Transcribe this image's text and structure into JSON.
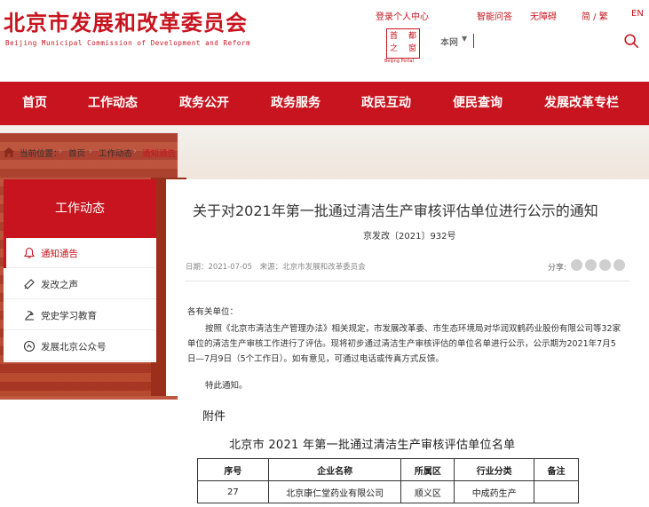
{
  "header": {
    "title_cn": "北京市发展和改革委员会",
    "title_en": "Beijing Municipal Commission of Development and Reform",
    "links": {
      "login": "登录个人中心",
      "elder": "智能问答",
      "accessibility": "无障碍",
      "lang": "简 / 繁",
      "en": "EN"
    },
    "seal": {
      "c1": "首",
      "c2": "都",
      "c3": "之",
      "c4": "窗",
      "label": "Beijing Portal"
    },
    "search": {
      "scope": "本网",
      "caret": "▼",
      "placeholder": ""
    }
  },
  "nav": {
    "items": [
      "首页",
      "工作动态",
      "政务公开",
      "政务服务",
      "政民互动",
      "便民查询",
      "发展改革专栏"
    ]
  },
  "breadcrumb": {
    "label": "当前位置：",
    "sep": "›",
    "home": "首页",
    "work": "工作动态",
    "current": "通知通告"
  },
  "sidebar": {
    "heading": "工作动态",
    "items": [
      {
        "label": "通知通告",
        "icon": "bell-icon"
      },
      {
        "label": "发改之声",
        "icon": "megaphone-icon"
      },
      {
        "label": "党史学习教育",
        "icon": "party-icon"
      },
      {
        "label": "发展北京公众号",
        "icon": "wechat-icon"
      }
    ]
  },
  "article": {
    "title": "关于对2021年第一批通过清洁生产审核评估单位进行公示的通知",
    "doc_no": "京发改〔2021〕932号",
    "date": "日期：2021-07-05",
    "source": "来源：北京市发展和改革委员会",
    "share_label": "分享:",
    "greeting": "各有关单位：",
    "body": "按照《北京市清洁生产管理办法》相关规定，市发展改革委、市生态环境局对华润双鹤药业股份有限公司等32家单位的清洁生产审核工作进行了评估。现将初步通过清洁生产审核评估的单位名单进行公示，公示期为2021年7月5日—7月9日（5个工作日）。如有意见，可通过电话或传真方式反馈。",
    "closing": "特此通知。"
  },
  "attachment": {
    "heading": "附件",
    "table_title": "北京市 2021 年第一批通过清洁生产审核评估单位名单",
    "columns": [
      "序号",
      "企业名称",
      "所属区",
      "行业分类",
      "备注"
    ],
    "rows": [
      [
        "27",
        "北京康仁堂药业有限公司",
        "顺义区",
        "中成药生产",
        ""
      ]
    ]
  },
  "colors": {
    "brand_red": "#c8141e"
  }
}
